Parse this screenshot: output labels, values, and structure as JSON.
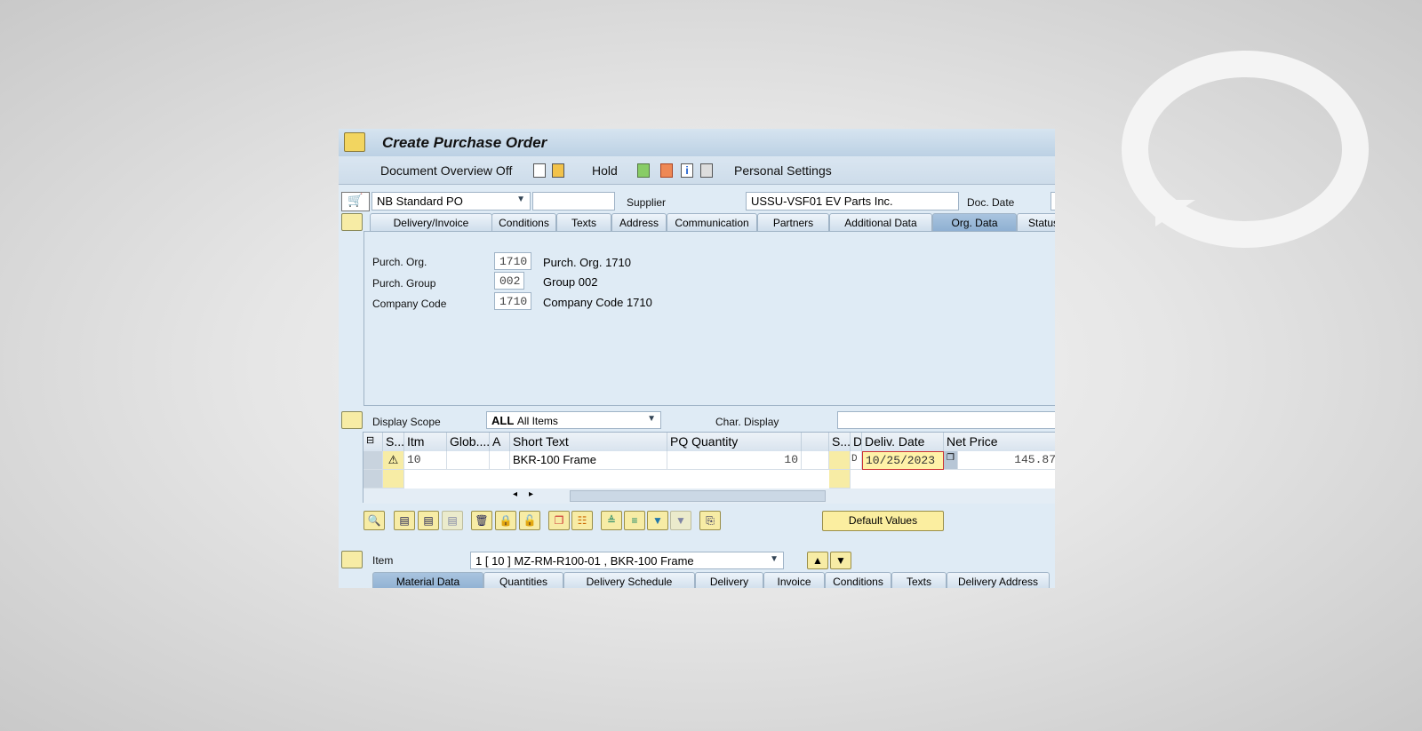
{
  "window": {
    "title": "Create Purchase Order"
  },
  "toolbar": {
    "doc_overview": "Document Overview Off",
    "hold": "Hold",
    "personal_settings": "Personal Settings"
  },
  "header": {
    "doc_type": "NB Standard PO",
    "supplier_label": "Supplier",
    "supplier_value": "USSU-VSF01 EV Parts Inc.",
    "doc_date_label": "Doc. Date"
  },
  "header_tabs": [
    "Delivery/Invoice",
    "Conditions",
    "Texts",
    "Address",
    "Communication",
    "Partners",
    "Additional Data",
    "Org. Data",
    "Status"
  ],
  "active_header_tab": "Org. Data",
  "org_data": [
    {
      "label": "Purch. Org.",
      "code": "1710",
      "desc": "Purch. Org. 1710"
    },
    {
      "label": "Purch. Group",
      "code": "002",
      "desc": "Group 002"
    },
    {
      "label": "Company Code",
      "code": "1710",
      "desc": "Company Code 1710"
    }
  ],
  "display_scope": {
    "label": "Display Scope",
    "value_code": "ALL",
    "value_text": "All Items",
    "char_display_label": "Char. Display"
  },
  "items_table": {
    "columns": [
      "S...",
      "Itm",
      "Glob....",
      "A",
      "Short Text",
      "PQ Quantity",
      "",
      "S...",
      "D",
      "Deliv. Date",
      "Net Price"
    ],
    "rows": [
      {
        "status_icon": "warning-icon",
        "item": "10",
        "short_text": "BKR-100 Frame",
        "quantity": "10",
        "d": "D",
        "deliv_date": "10/25/2023",
        "net_price": "145.87"
      }
    ]
  },
  "default_values_label": "Default Values",
  "item_selector": {
    "label": "Item",
    "value": "1 [ 10 ] MZ-RM-R100-01 , BKR-100 Frame"
  },
  "item_tabs": [
    "Material Data",
    "Quantities",
    "Delivery Schedule",
    "Delivery",
    "Invoice",
    "Conditions",
    "Texts",
    "Delivery Address"
  ],
  "active_item_tab": "Material Data",
  "colors": {
    "accent_yellow": "#f7eca5",
    "tab_active": "#8fb0d2",
    "panel": "#dfebf5"
  }
}
